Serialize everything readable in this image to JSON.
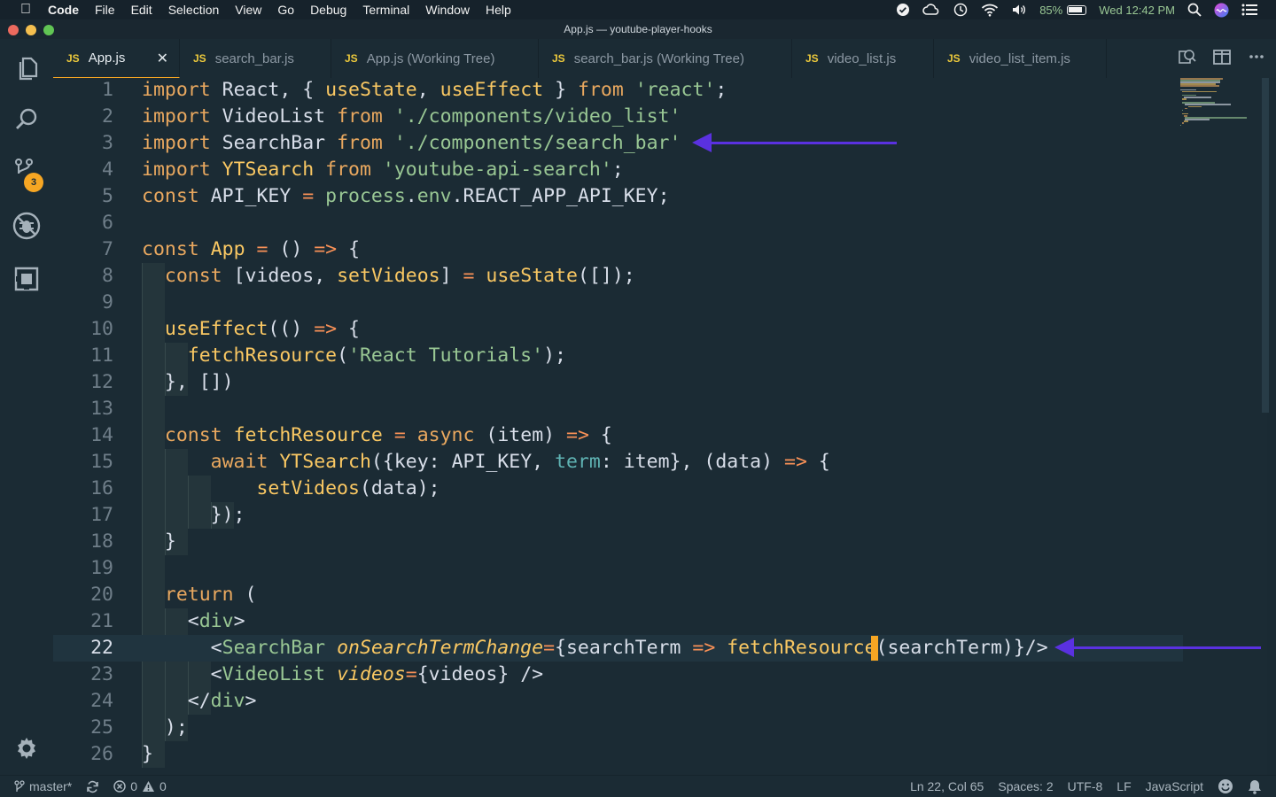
{
  "menubar": {
    "app": "Code",
    "items": [
      "File",
      "Edit",
      "Selection",
      "View",
      "Go",
      "Debug",
      "Terminal",
      "Window",
      "Help"
    ],
    "battery": "85%",
    "clock": "Wed 12:42 PM"
  },
  "window": {
    "title": "App.js — youtube-player-hooks"
  },
  "activity": {
    "scm_badge": "3"
  },
  "tabs": [
    {
      "icon": "JS",
      "label": "App.js"
    },
    {
      "icon": "JS",
      "label": "search_bar.js"
    },
    {
      "icon": "JS",
      "label": "App.js (Working Tree)"
    },
    {
      "icon": "JS",
      "label": "search_bar.js (Working Tree)"
    },
    {
      "icon": "JS",
      "label": "video_list.js"
    },
    {
      "icon": "JS",
      "label": "video_list_item.js"
    }
  ],
  "editor": {
    "language": "JavaScript",
    "current_line": 22,
    "line_numbers": [
      "1",
      "2",
      "3",
      "4",
      "5",
      "6",
      "7",
      "8",
      "9",
      "10",
      "11",
      "12",
      "13",
      "14",
      "15",
      "16",
      "17",
      "18",
      "19",
      "20",
      "21",
      "22",
      "23",
      "24",
      "25",
      "26"
    ],
    "lines": [
      "import React, { useState, useEffect } from 'react';",
      "import VideoList from './components/video_list'",
      "import SearchBar from './components/search_bar'",
      "import YTSearch from 'youtube-api-search';",
      "const API_KEY = process.env.REACT_APP_API_KEY;",
      "",
      "const App = () => {",
      "  const [videos, setVideos] = useState([]);",
      "",
      "  useEffect(() => {",
      "    fetchResource('React Tutorials');",
      "  }, [])",
      "",
      "  const fetchResource = async (item) => {",
      "      await YTSearch({key: API_KEY, term: item}, (data) => {",
      "          setVideos(data);",
      "      });",
      "  }",
      "",
      "  return (",
      "    <div>",
      "      <SearchBar onSearchTermChange={searchTerm => fetchResource(searchTerm)}/>",
      "      <VideoList videos={videos} />",
      "    </div>",
      "  );",
      "}"
    ]
  },
  "statusbar": {
    "branch": "master*",
    "errors": "0",
    "warnings": "0",
    "position": "Ln 22, Col 65",
    "spaces": "Spaces: 2",
    "encoding": "UTF-8",
    "eol": "LF",
    "language": "JavaScript"
  },
  "colors": {
    "background": "#1b2b34",
    "keyword": "#e9a85f",
    "string": "#99c794",
    "function": "#fac863",
    "arrow_annotation": "#5a31e0",
    "badge": "#f6a623"
  }
}
